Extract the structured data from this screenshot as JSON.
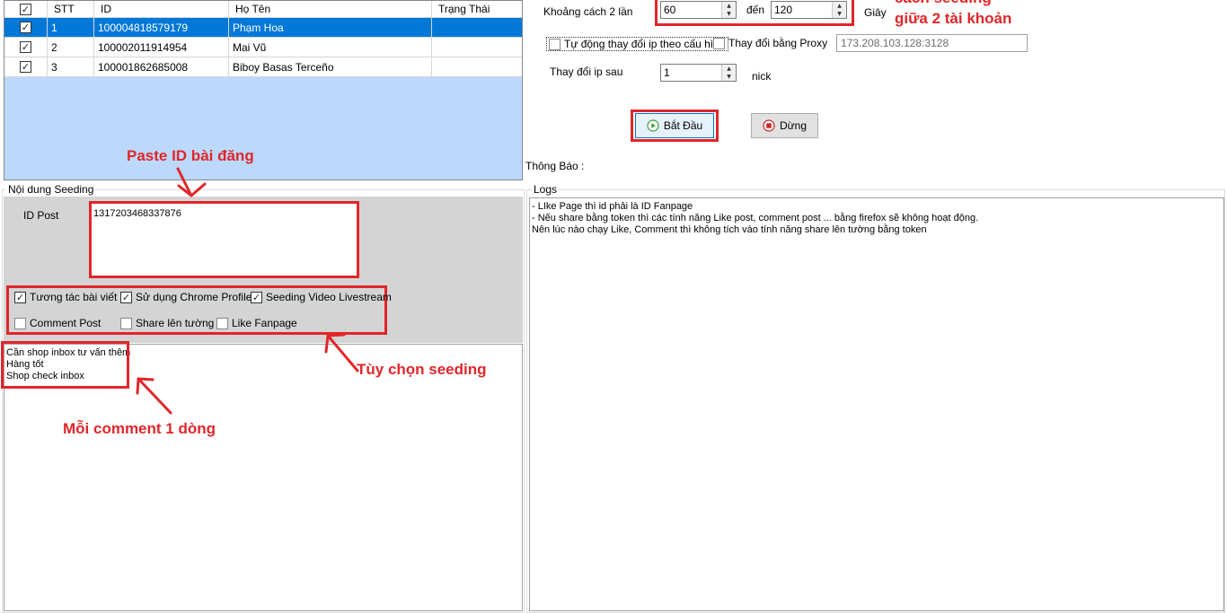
{
  "grid": {
    "headers": {
      "check": "☑",
      "stt": "STT",
      "id": "ID",
      "name": "Họ Tên",
      "status": "Trạng Thái"
    },
    "rows": [
      {
        "check": "☑",
        "stt": "1",
        "id": "100004818579179",
        "name": "Phạm Hoa",
        "status": "",
        "selected": true
      },
      {
        "check": "☑",
        "stt": "2",
        "id": "100002011914954",
        "name": "Mai Vũ",
        "status": "",
        "selected": false
      },
      {
        "check": "☑",
        "stt": "3",
        "id": "100001862685008",
        "name": "Biboy Basas Terceño",
        "status": "",
        "selected": false
      }
    ]
  },
  "settings": {
    "interval_label": "Khoảng cách 2 lần",
    "interval_from": "60",
    "interval_to_label": "đến",
    "interval_to": "120",
    "interval_unit": "Giây",
    "auto_ip_label": "Tự động thay đổi ip theo cấu hình",
    "proxy_label": "Thay đổi bằng Proxy",
    "proxy_value": "173.208.103.128:3128",
    "change_ip_label": "Thay đổi ip sau",
    "change_ip_value": "1",
    "change_ip_unit": "nick",
    "start_label": "Bắt Đầu",
    "stop_label": "Dừng",
    "notice_label": "Thông Báo :"
  },
  "seeding": {
    "group_title": "Nội dung Seeding",
    "id_post_label": "ID Post",
    "id_post_value": "1317203468337876",
    "options": {
      "interact": "Tương tác bài viết",
      "chrome_profile": "Sử dụng Chrome Profile",
      "livestream": "Seeding Video Livestream",
      "comment_post": "Comment Post",
      "share_wall": "Share lên tường",
      "like_fanpage": "Like Fanpage"
    },
    "comments": [
      "Cần shop inbox tư vấn thêm",
      "Hàng tốt",
      "Shop check inbox"
    ]
  },
  "logs": {
    "group_title": "Logs",
    "lines": [
      "- LIke Page thì id phải là ID Fanpage",
      "- Nếu share bằng token thì các tính năng Like post, comment post ... bằng firefox sẽ không hoạt động.",
      "Nên lúc nào chạy Like, Comment thì không tích vào tính năng share lên tường bằng token"
    ]
  },
  "annotations": {
    "paste_id": "Paste ID bài đăng",
    "options": "Tùy chọn seeding",
    "one_per_line": "Mỗi comment 1 dòng",
    "interval_note_line1": "cách seeding",
    "interval_note_line2": "giữa 2 tài khoản",
    "color": "#e0262a"
  },
  "icons": {
    "check": "check-icon",
    "play": "play-icon",
    "stop": "stop-icon",
    "spin_up": "spin-up-icon",
    "spin_down": "spin-down-icon",
    "arrow": "red-arrow-icon"
  },
  "colors": {
    "selection": "#0078d7",
    "grid_empty": "#bcd9fb",
    "panel": "#d4d4d4",
    "annotation": "#e0262a"
  }
}
